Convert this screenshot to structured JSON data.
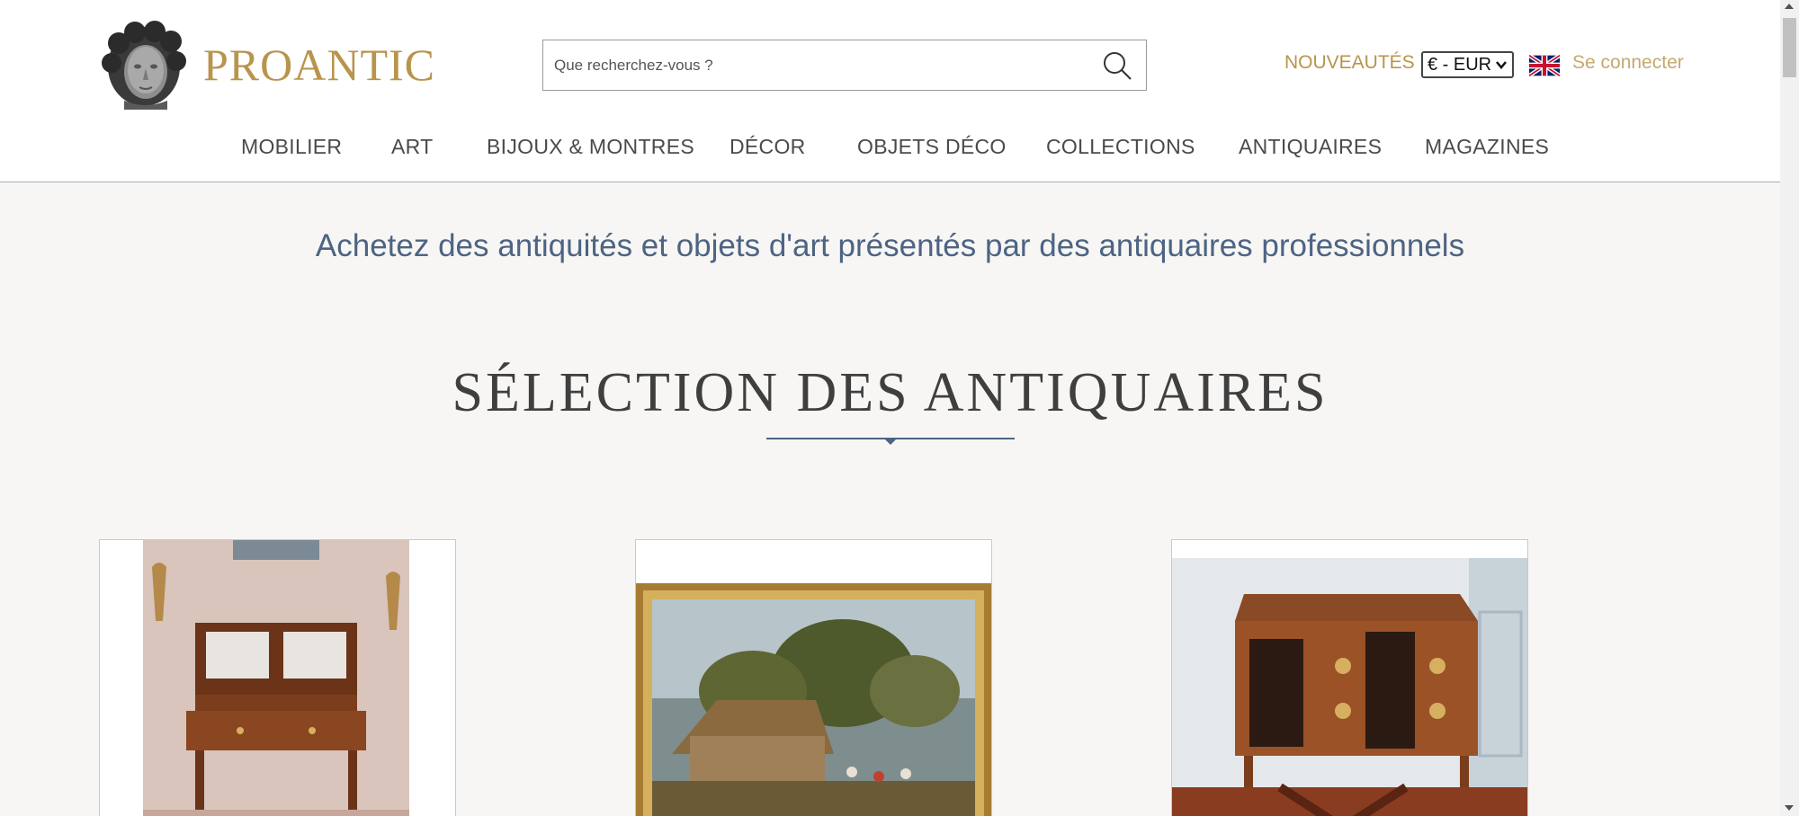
{
  "brand": {
    "name": "PROANTIC",
    "logo_icon": "bust-statue-icon"
  },
  "search": {
    "placeholder": "Que recherchez-vous ?",
    "value": "",
    "icon": "search-icon"
  },
  "header_right": {
    "new_label": "NOUVEAUTÉS",
    "currency": "€ - EUR",
    "language_flag": "uk-flag-icon",
    "login_label": "Se connecter"
  },
  "nav": {
    "items": [
      {
        "label": "MOBILIER"
      },
      {
        "label": "ART"
      },
      {
        "label": "BIJOUX & MONTRES"
      },
      {
        "label": "DÉCOR"
      },
      {
        "label": "OBJETS DÉCO"
      },
      {
        "label": "COLLECTIONS"
      },
      {
        "label": "ANTIQUAIRES"
      },
      {
        "label": "MAGAZINES"
      }
    ]
  },
  "main": {
    "tagline": "Achetez des antiquités et objets d'art présentés par des antiquaires professionnels",
    "section_title": "SÉLECTION DES ANTIQUAIRES"
  },
  "cards": [
    {
      "image": "secretary-desk-photo"
    },
    {
      "image": "landscape-painting-photo"
    },
    {
      "image": "commode-photo"
    }
  ],
  "colors": {
    "gold": "#b8944c",
    "gold_light": "#c5a96e",
    "blue_text": "#4d6483",
    "background": "#f7f6f4"
  }
}
